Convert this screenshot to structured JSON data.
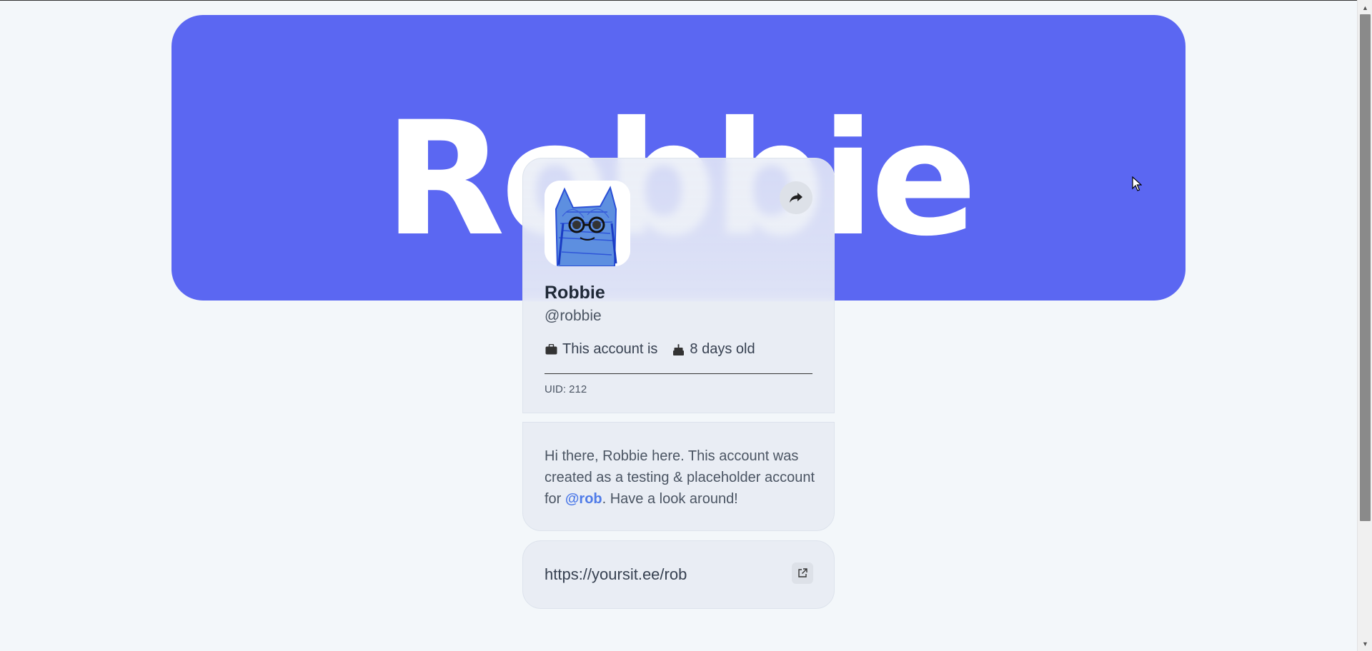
{
  "banner": {
    "name": "Robbie",
    "color": "#5b67f2"
  },
  "profile": {
    "display_name": "Robbie",
    "handle": "@robbie",
    "account_label": "This account is",
    "age_label": "8 days old",
    "uid": "UID: 212",
    "avatar_icon": "cat-drawing-avatar",
    "share_icon": "share-icon"
  },
  "bio": {
    "before": "Hi there, Robbie here. This account was created as a testing & placeholder account for ",
    "mention": "@rob",
    "after": ". Have a look around!"
  },
  "link": {
    "url": "https://yoursit.ee/rob",
    "icon": "external-link-icon"
  },
  "colors": {
    "accent": "#4f7be8",
    "background": "#f3f7fa",
    "card": "#e9edf4"
  }
}
